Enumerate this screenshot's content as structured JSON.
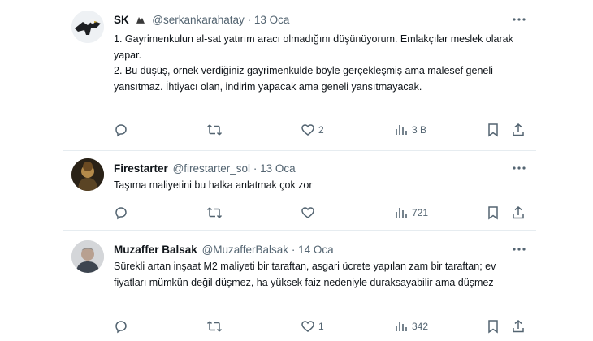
{
  "tweets": [
    {
      "name": "SK",
      "handle": "@serkankarahatay",
      "separator": "·",
      "date": "13 Oca",
      "body": "1. Gayrimenkulun al-sat yatırım aracı olmadığını düşünüyorum. Emlakçılar meslek olarak yapar.\n2. Bu düşüş, örnek verdiğiniz gayrimenkulde böyle gerçekleşmiş ama malesef geneli yansıtmaz. İhtiyacı olan, indirim yapacak ama geneli yansıtmayacak.",
      "replies": "",
      "retweets": "",
      "likes": "2",
      "views": "3 B"
    },
    {
      "name": "Firestarter",
      "handle": "@firestarter_sol",
      "separator": "·",
      "date": "13 Oca",
      "body": "Taşıma maliyetini bu halka anlatmak çok zor",
      "replies": "",
      "retweets": "",
      "likes": "",
      "views": "721"
    },
    {
      "name": "Muzaffer Balsak",
      "handle": "@MuzafferBalsak",
      "separator": "·",
      "date": "14 Oca",
      "body": "Sürekli artan inşaat M2 maliyeti bir taraftan, asgari ücrete  yapılan zam bir taraftan;  ev fiyatları mümkün değil düşmez, ha yüksek faiz nedeniyle duraksayabilir ama düşmez",
      "replies": "",
      "retweets": "",
      "likes": "1",
      "views": "342"
    }
  ],
  "colors": {
    "text": "#0f1419",
    "secondary": "#536471",
    "divider": "#e6ecf0",
    "background": "#ffffff"
  },
  "icons": [
    "more-icon",
    "reply-icon",
    "retweet-icon",
    "like-icon",
    "views-icon",
    "bookmark-icon",
    "share-icon",
    "verified-badge-icon"
  ]
}
